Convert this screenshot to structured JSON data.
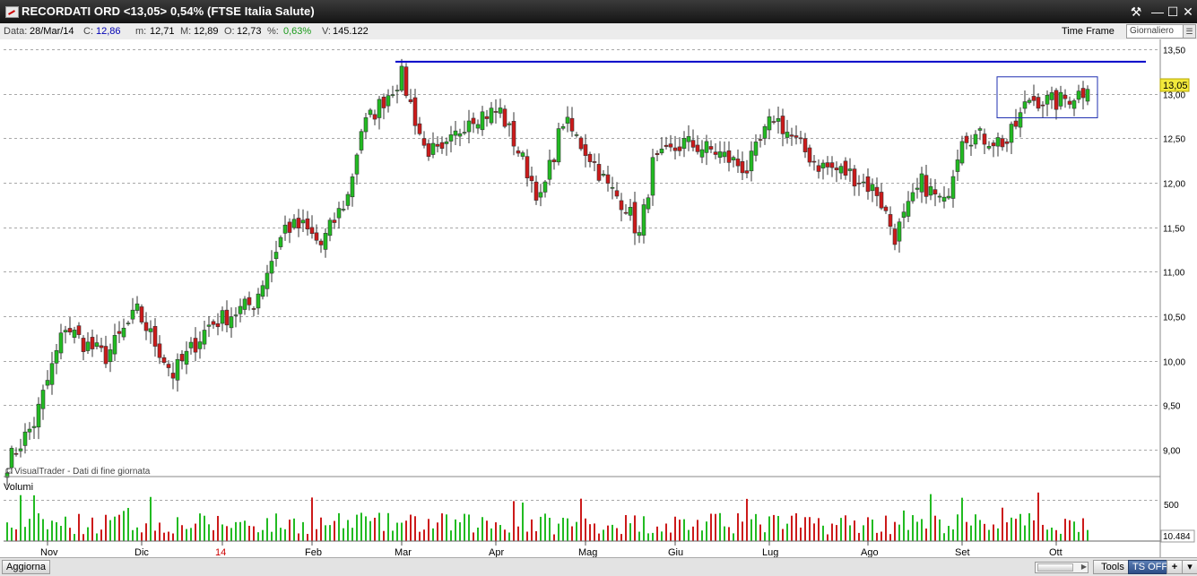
{
  "window": {
    "title": "RECORDATI ORD <13,05> 0,54%  (FTSE Italia Salute)",
    "controls": [
      "tools-icon",
      "minimize-icon",
      "maximize-icon",
      "close-icon"
    ]
  },
  "info": {
    "date_label": "Data:",
    "date_value": "28/Mar/14",
    "close_label": "C:",
    "close_value": "12,86",
    "min_label": "m:",
    "min_value": "12,71",
    "max_label": "M:",
    "max_value": "12,89",
    "open_label": "O:",
    "open_value": "12,73",
    "pct_label": "%:",
    "pct_value": "0,63%",
    "vol_label": "V:",
    "vol_value": "145.122",
    "timeframe_label": "Time Frame",
    "timeframe_value": "Giornaliero"
  },
  "chart": {
    "credit": "© VisualTrader - Dati di fine giornata",
    "volume_label": "Volumi",
    "volume_tick": "500",
    "volume_last": "10.484",
    "last_price_label": "13,05",
    "up_color": "#22bb22",
    "down_color": "#cc1a1a",
    "resistance_color": "#0000c8"
  },
  "chart_data": {
    "type": "candlestick",
    "price_axis": {
      "min": 8.8,
      "max": 13.55,
      "ticks": [
        {
          "value": 13.5,
          "label": "13,50"
        },
        {
          "value": 13.0,
          "label": "13,00"
        },
        {
          "value": 12.5,
          "label": "12,50"
        },
        {
          "value": 12.0,
          "label": "12,00"
        },
        {
          "value": 11.5,
          "label": "11,50"
        },
        {
          "value": 11.0,
          "label": "11,00"
        },
        {
          "value": 10.5,
          "label": "10,50"
        },
        {
          "value": 10.0,
          "label": "10,00"
        },
        {
          "value": 9.5,
          "label": "9,50"
        },
        {
          "value": 9.0,
          "label": "9,00"
        }
      ]
    },
    "volume_axis": {
      "max": 700,
      "ticks": [
        {
          "value": 500,
          "label": "500"
        }
      ]
    },
    "x_labels": [
      {
        "index": 9,
        "label": "Nov",
        "red": false
      },
      {
        "index": 30,
        "label": "Dic",
        "red": false
      },
      {
        "index": 48,
        "label": "14",
        "red": true
      },
      {
        "index": 68,
        "label": "Feb",
        "red": false
      },
      {
        "index": 88,
        "label": "Mar",
        "red": false
      },
      {
        "index": 109,
        "label": "Apr",
        "red": false
      },
      {
        "index": 129,
        "label": "Mag",
        "red": false
      },
      {
        "index": 149,
        "label": "Giu",
        "red": false
      },
      {
        "index": 170,
        "label": "Lug",
        "red": false
      },
      {
        "index": 192,
        "label": "Ago",
        "red": false
      },
      {
        "index": 213,
        "label": "Set",
        "red": false
      },
      {
        "index": 234,
        "label": "Ott",
        "red": false
      }
    ],
    "resistance": 13.36,
    "resistance_start_index": 87,
    "highlight": {
      "from_index": 222,
      "to_index": 242,
      "low": 12.73,
      "high": 13.19
    },
    "anchors": [
      {
        "i": 0,
        "c": 8.85
      },
      {
        "i": 6,
        "c": 9.3
      },
      {
        "i": 13,
        "c": 10.4
      },
      {
        "i": 17,
        "c": 10.2
      },
      {
        "i": 22,
        "c": 10.05
      },
      {
        "i": 29,
        "c": 10.55
      },
      {
        "i": 37,
        "c": 9.85
      },
      {
        "i": 45,
        "c": 10.4
      },
      {
        "i": 55,
        "c": 10.65
      },
      {
        "i": 62,
        "c": 11.5
      },
      {
        "i": 66,
        "c": 11.5
      },
      {
        "i": 70,
        "c": 11.3
      },
      {
        "i": 76,
        "c": 11.85
      },
      {
        "i": 79,
        "c": 12.6
      },
      {
        "i": 88,
        "c": 13.2
      },
      {
        "i": 93,
        "c": 12.4
      },
      {
        "i": 97,
        "c": 12.3
      },
      {
        "i": 103,
        "c": 12.75
      },
      {
        "i": 110,
        "c": 12.8
      },
      {
        "i": 115,
        "c": 12.25
      },
      {
        "i": 119,
        "c": 11.8
      },
      {
        "i": 124,
        "c": 12.7
      },
      {
        "i": 130,
        "c": 12.3
      },
      {
        "i": 134,
        "c": 11.95
      },
      {
        "i": 138,
        "c": 11.75
      },
      {
        "i": 141,
        "c": 11.4
      },
      {
        "i": 144,
        "c": 12.2
      },
      {
        "i": 151,
        "c": 12.45
      },
      {
        "i": 158,
        "c": 12.35
      },
      {
        "i": 165,
        "c": 12.15
      },
      {
        "i": 171,
        "c": 12.75
      },
      {
        "i": 176,
        "c": 12.45
      },
      {
        "i": 181,
        "c": 12.2
      },
      {
        "i": 188,
        "c": 12.1
      },
      {
        "i": 194,
        "c": 11.9
      },
      {
        "i": 198,
        "c": 11.4
      },
      {
        "i": 204,
        "c": 12.0
      },
      {
        "i": 209,
        "c": 11.75
      },
      {
        "i": 213,
        "c": 12.55
      },
      {
        "i": 218,
        "c": 12.5
      },
      {
        "i": 223,
        "c": 12.45
      },
      {
        "i": 228,
        "c": 12.95
      },
      {
        "i": 234,
        "c": 12.9
      },
      {
        "i": 241,
        "c": 13.05
      }
    ],
    "count": 242
  }
}
